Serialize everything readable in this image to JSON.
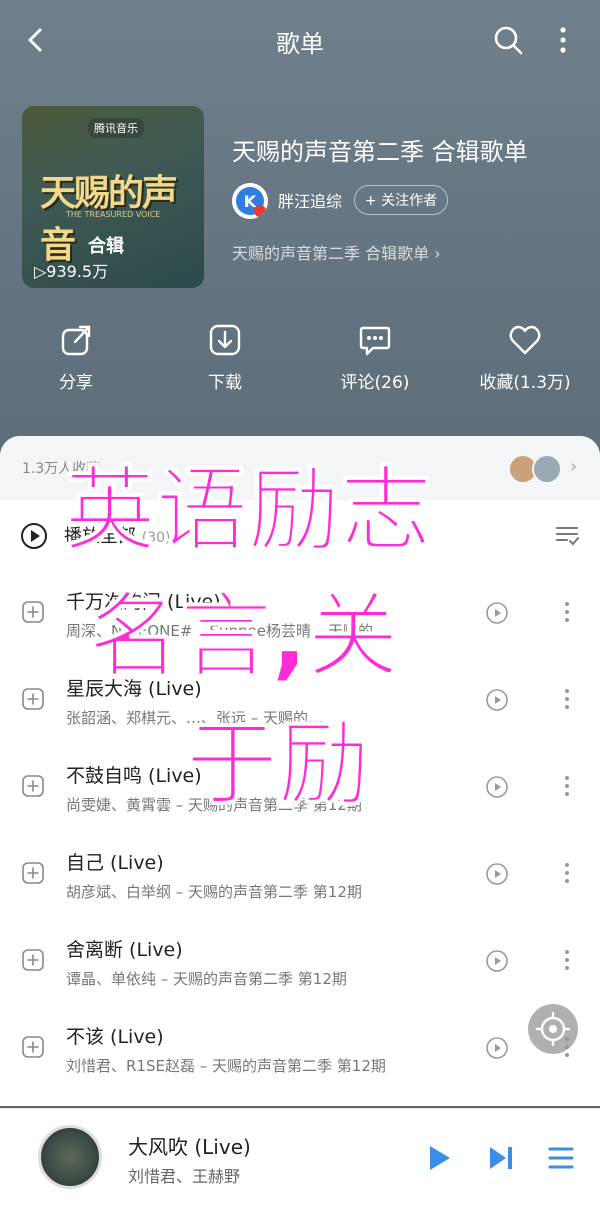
{
  "header": {
    "title": "歌单"
  },
  "album": {
    "brand": "腾讯音乐",
    "cover_title": "天赐的声音",
    "cover_subtitle": "THE TREASURED VOICE",
    "cover_tag": "合辑",
    "play_count": "▷939.5万",
    "title": "天赐的声音第二季 合辑歌单",
    "author": "胖汪追综",
    "follow_label": "+ 关注作者",
    "description": "天赐的声音第二季 合辑歌单 ›"
  },
  "actions": [
    {
      "label": "分享",
      "icon": "share-icon"
    },
    {
      "label": "下载",
      "icon": "download-icon"
    },
    {
      "label": "评论(26)",
      "icon": "comment-icon"
    },
    {
      "label": "收藏(1.3万)",
      "icon": "heart-icon"
    }
  ],
  "collect": {
    "text": "1.3万人收藏"
  },
  "playall": {
    "label": "播放全部",
    "count": "(30)"
  },
  "songs": [
    {
      "name": "千万次的问 (Live)",
      "meta": "周深、NINEONE# – Sunnee杨芸晴 – 天赐的…"
    },
    {
      "name": "星辰大海 (Live)",
      "meta": "张韶涵、郑棋元、…、张远 – 天赐的…"
    },
    {
      "name": "不鼓自鸣 (Live)",
      "meta": "尚雯婕、黄霄雲 – 天赐的声音第二季 第12期"
    },
    {
      "name": "自己 (Live)",
      "meta": "胡彦斌、白举纲 – 天赐的声音第二季 第12期"
    },
    {
      "name": "舍离断 (Live)",
      "meta": "谭晶、单依纯 – 天赐的声音第二季 第12期"
    },
    {
      "name": "不该 (Live)",
      "meta": "刘惜君、R1SE赵磊 – 天赐的声音第二季 第12期"
    }
  ],
  "player": {
    "title": "大风吹 (Live)",
    "artist": "刘惜君、王赫野"
  },
  "watermark": {
    "line1": "英语励志",
    "line2": "名言,关",
    "line3": "于励"
  },
  "colors": {
    "accent": "#3a8ee6",
    "watermark": "#ff2bd6"
  }
}
